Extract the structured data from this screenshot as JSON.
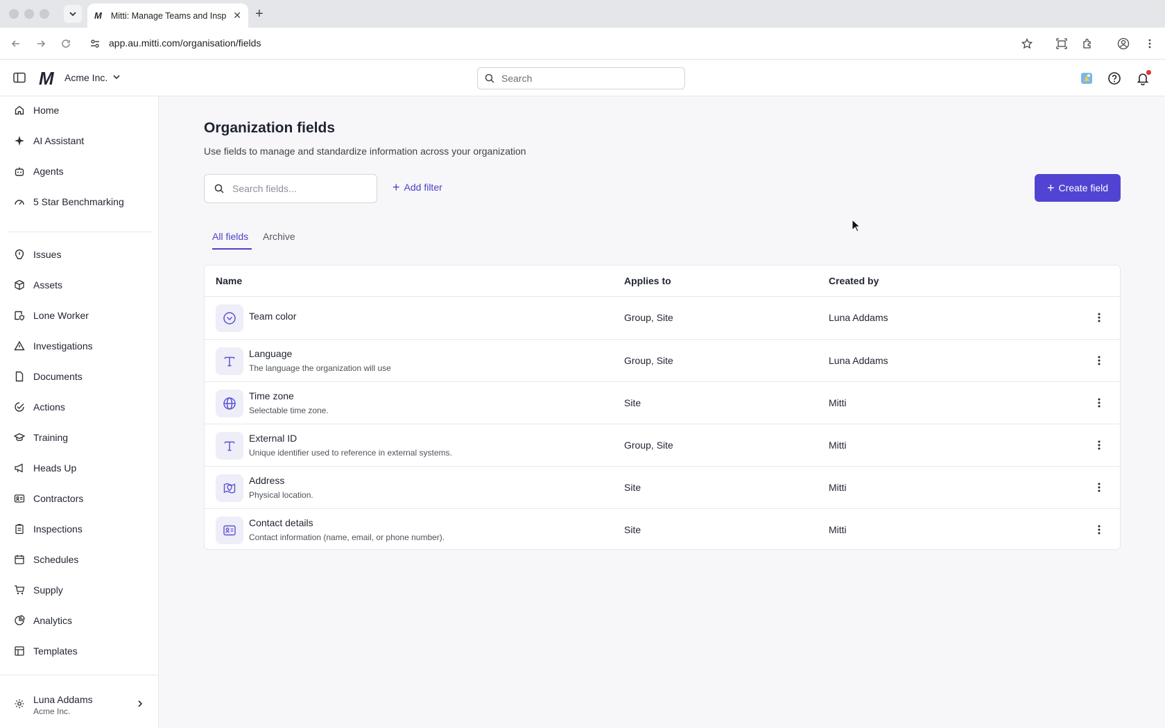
{
  "browser": {
    "tab_title": "Mitti: Manage Teams and Insp",
    "url": "app.au.mitti.com/organisation/fields"
  },
  "header": {
    "org_name": "Acme Inc.",
    "search_placeholder": "Search"
  },
  "sidebar": {
    "items": [
      {
        "label": "Home",
        "icon": "home-icon"
      },
      {
        "label": "AI Assistant",
        "icon": "sparkle-icon"
      },
      {
        "label": "Agents",
        "icon": "robot-icon"
      },
      {
        "label": "5 Star Benchmarking",
        "icon": "gauge-icon"
      },
      {
        "label": "Issues",
        "icon": "alert-icon"
      },
      {
        "label": "Assets",
        "icon": "cube-icon"
      },
      {
        "label": "Lone Worker",
        "icon": "person-shield-icon"
      },
      {
        "label": "Investigations",
        "icon": "triangle-warning-icon"
      },
      {
        "label": "Documents",
        "icon": "document-icon"
      },
      {
        "label": "Actions",
        "icon": "check-circle-icon"
      },
      {
        "label": "Training",
        "icon": "graduation-cap-icon"
      },
      {
        "label": "Heads Up",
        "icon": "megaphone-icon"
      },
      {
        "label": "Contractors",
        "icon": "id-card-icon"
      },
      {
        "label": "Inspections",
        "icon": "clipboard-icon"
      },
      {
        "label": "Schedules",
        "icon": "calendar-icon"
      },
      {
        "label": "Supply",
        "icon": "cart-icon"
      },
      {
        "label": "Analytics",
        "icon": "pie-chart-icon"
      },
      {
        "label": "Templates",
        "icon": "template-icon"
      }
    ],
    "user": {
      "name": "Luna Addams",
      "org": "Acme Inc."
    }
  },
  "main": {
    "title": "Organization fields",
    "subtitle": "Use fields to manage and standardize information across your organization",
    "search_placeholder": "Search fields...",
    "add_filter_label": "Add filter",
    "create_label": "Create field",
    "tabs": [
      {
        "label": "All fields",
        "active": true
      },
      {
        "label": "Archive",
        "active": false
      }
    ],
    "columns": {
      "name": "Name",
      "applies_to": "Applies to",
      "created_by": "Created by"
    },
    "rows": [
      {
        "name": "Team color",
        "description": "",
        "applies_to": "Group, Site",
        "created_by": "Luna Addams",
        "icon": "dropdown-circle-icon"
      },
      {
        "name": "Language",
        "description": "The language the organization will use",
        "applies_to": "Group, Site",
        "created_by": "Luna Addams",
        "icon": "text-icon"
      },
      {
        "name": "Time zone",
        "description": "Selectable time zone.",
        "applies_to": "Site",
        "created_by": "Mitti",
        "icon": "globe-icon"
      },
      {
        "name": "External ID",
        "description": "Unique identifier used to reference in external systems.",
        "applies_to": "Group, Site",
        "created_by": "Mitti",
        "icon": "text-icon"
      },
      {
        "name": "Address",
        "description": "Physical location.",
        "applies_to": "Site",
        "created_by": "Mitti",
        "icon": "map-pin-icon"
      },
      {
        "name": "Contact details",
        "description": "Contact information (name, email, or phone number).",
        "applies_to": "Site",
        "created_by": "Mitti",
        "icon": "contact-card-icon"
      }
    ]
  },
  "colors": {
    "accent": "#5144d3",
    "accent_text": "#4b3fc8",
    "icon_bg": "#eeeef8"
  }
}
